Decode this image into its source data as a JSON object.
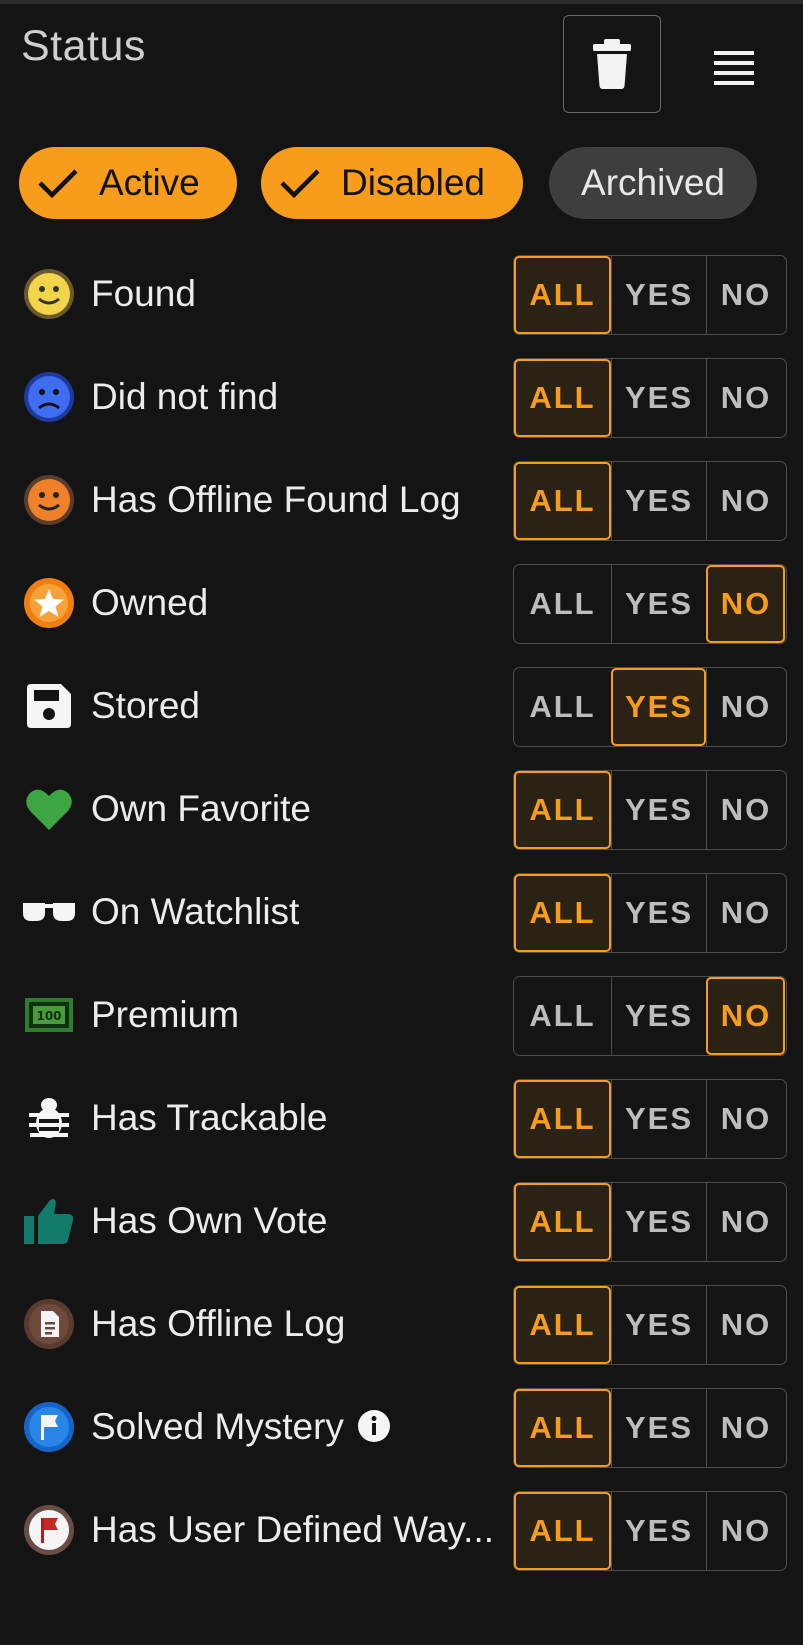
{
  "header": {
    "title": "Status"
  },
  "status_chips": [
    {
      "label": "Active",
      "selected": true
    },
    {
      "label": "Disabled",
      "selected": true
    },
    {
      "label": "Archived",
      "selected": false
    }
  ],
  "segment_options": [
    "ALL",
    "YES",
    "NO"
  ],
  "filters": [
    {
      "label": "Found",
      "icon": "smiley-found-icon",
      "value": "ALL"
    },
    {
      "label": "Did not find",
      "icon": "sad-face-icon",
      "value": "ALL"
    },
    {
      "label": "Has Offline Found Log",
      "icon": "offline-found-smiley-icon",
      "value": "ALL"
    },
    {
      "label": "Owned",
      "icon": "star-badge-icon",
      "value": "NO"
    },
    {
      "label": "Stored",
      "icon": "floppy-disk-icon",
      "value": "YES"
    },
    {
      "label": "Own Favorite",
      "icon": "heart-icon",
      "value": "ALL"
    },
    {
      "label": "On Watchlist",
      "icon": "sunglasses-icon",
      "value": "ALL"
    },
    {
      "label": "Premium",
      "icon": "banknote-100-icon",
      "value": "NO"
    },
    {
      "label": "Has Trackable",
      "icon": "bug-icon",
      "value": "ALL"
    },
    {
      "label": "Has Own Vote",
      "icon": "thumbs-up-icon",
      "value": "ALL"
    },
    {
      "label": "Has Offline Log",
      "icon": "document-badge-icon",
      "value": "ALL"
    },
    {
      "label": "Solved Mystery",
      "icon": "blue-flag-badge-icon",
      "value": "ALL",
      "info": true
    },
    {
      "label": "Has User Defined Way...",
      "icon": "red-flag-badge-icon",
      "value": "ALL"
    }
  ],
  "colors": {
    "accent": "#f89c1c",
    "background": "#141414",
    "chip_off": "#3e3e3e",
    "favorite_green": "#3da542",
    "vote_teal": "#127b6c"
  }
}
